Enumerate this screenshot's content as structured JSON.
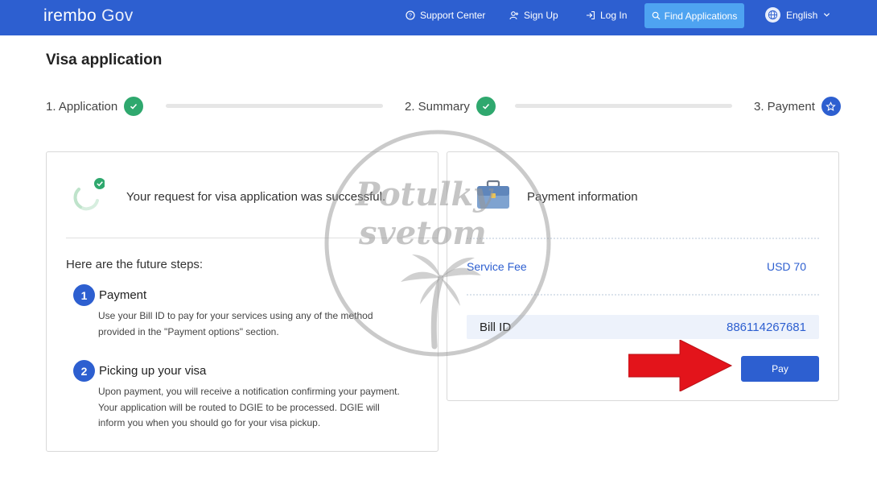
{
  "header": {
    "brand": "irembo",
    "brand_suffix": "Gov",
    "support_label": "Support Center",
    "signup_label": "Sign Up",
    "login_label": "Log In",
    "find_label": "Find Applications",
    "language": "English"
  },
  "page_title": "Visa application",
  "steps": [
    {
      "label": "1. Application",
      "status": "done"
    },
    {
      "label": "2. Summary",
      "status": "done"
    },
    {
      "label": "3. Payment",
      "status": "current"
    }
  ],
  "success": {
    "message": "Your request for visa application was successful."
  },
  "future": {
    "title": "Here are the future steps:",
    "items": [
      {
        "number": "1",
        "heading": "Payment",
        "body": "Use your Bill ID to pay for your services using any of the method provided in the \"Payment options\" section."
      },
      {
        "number": "2",
        "heading": "Picking up your visa",
        "body": "Upon payment, you will receive a notification confirming your payment. Your application will be routed to DGIE to be processed. DGIE will inform you when you should go for your visa pickup."
      }
    ]
  },
  "payment": {
    "title": "Payment information",
    "fee_label": "Service Fee",
    "fee_value": "USD 70",
    "bill_label": "Bill ID",
    "bill_value": "886114267681",
    "pay_label": "Pay"
  },
  "watermark": {
    "line1": "Potulky",
    "line2": "svetom"
  },
  "colors": {
    "primary": "#2d5fd0",
    "success": "#2fa86e",
    "accent": "#4ea3f1",
    "arrow": "#e3141b"
  }
}
